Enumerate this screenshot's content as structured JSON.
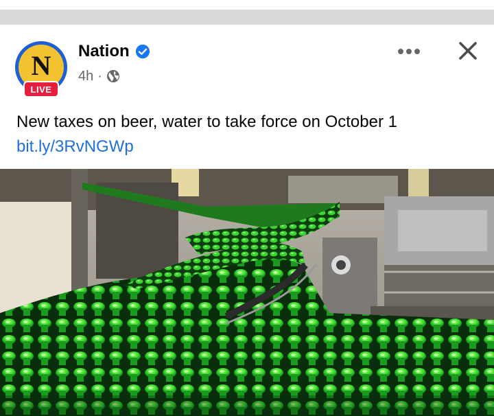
{
  "post": {
    "author": {
      "name": "Nation",
      "avatar_letter": "N",
      "live_badge": "LIVE",
      "verified": true
    },
    "timestamp": "4h",
    "meta_separator": "·",
    "audience_icon": "globe-icon",
    "more_icon": "more-options-icon",
    "close_icon": "close-icon",
    "caption": "New taxes on beer, water to take force on October 1",
    "link_text": "bit.ly/3RvNGWp",
    "photo": "bottling-line-photo"
  },
  "colors": {
    "link": "#216fdb",
    "live_badge": "#e41e3f",
    "verified": "#1877f2",
    "avatar_ring": "#1d5fd6",
    "avatar_fill": "#f2c230",
    "meta_text": "#65676b"
  }
}
